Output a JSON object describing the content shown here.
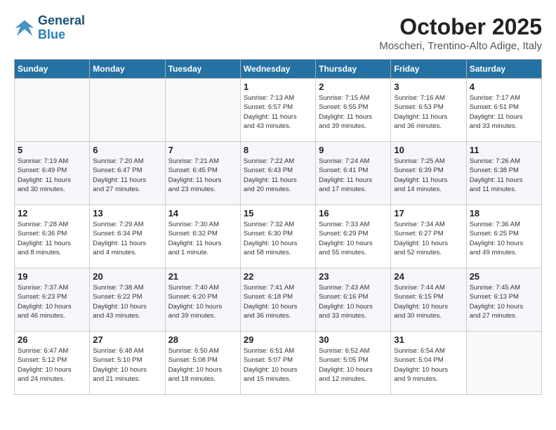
{
  "header": {
    "logo_line1": "General",
    "logo_line2": "Blue",
    "month": "October 2025",
    "location": "Moscheri, Trentino-Alto Adige, Italy"
  },
  "weekdays": [
    "Sunday",
    "Monday",
    "Tuesday",
    "Wednesday",
    "Thursday",
    "Friday",
    "Saturday"
  ],
  "weeks": [
    [
      {
        "day": "",
        "info": ""
      },
      {
        "day": "",
        "info": ""
      },
      {
        "day": "",
        "info": ""
      },
      {
        "day": "1",
        "info": "Sunrise: 7:13 AM\nSunset: 6:57 PM\nDaylight: 11 hours\nand 43 minutes."
      },
      {
        "day": "2",
        "info": "Sunrise: 7:15 AM\nSunset: 6:55 PM\nDaylight: 11 hours\nand 39 minutes."
      },
      {
        "day": "3",
        "info": "Sunrise: 7:16 AM\nSunset: 6:53 PM\nDaylight: 11 hours\nand 36 minutes."
      },
      {
        "day": "4",
        "info": "Sunrise: 7:17 AM\nSunset: 6:51 PM\nDaylight: 11 hours\nand 33 minutes."
      }
    ],
    [
      {
        "day": "5",
        "info": "Sunrise: 7:19 AM\nSunset: 6:49 PM\nDaylight: 11 hours\nand 30 minutes."
      },
      {
        "day": "6",
        "info": "Sunrise: 7:20 AM\nSunset: 6:47 PM\nDaylight: 11 hours\nand 27 minutes."
      },
      {
        "day": "7",
        "info": "Sunrise: 7:21 AM\nSunset: 6:45 PM\nDaylight: 11 hours\nand 23 minutes."
      },
      {
        "day": "8",
        "info": "Sunrise: 7:22 AM\nSunset: 6:43 PM\nDaylight: 11 hours\nand 20 minutes."
      },
      {
        "day": "9",
        "info": "Sunrise: 7:24 AM\nSunset: 6:41 PM\nDaylight: 11 hours\nand 17 minutes."
      },
      {
        "day": "10",
        "info": "Sunrise: 7:25 AM\nSunset: 6:39 PM\nDaylight: 11 hours\nand 14 minutes."
      },
      {
        "day": "11",
        "info": "Sunrise: 7:26 AM\nSunset: 6:38 PM\nDaylight: 11 hours\nand 11 minutes."
      }
    ],
    [
      {
        "day": "12",
        "info": "Sunrise: 7:28 AM\nSunset: 6:36 PM\nDaylight: 11 hours\nand 8 minutes."
      },
      {
        "day": "13",
        "info": "Sunrise: 7:29 AM\nSunset: 6:34 PM\nDaylight: 11 hours\nand 4 minutes."
      },
      {
        "day": "14",
        "info": "Sunrise: 7:30 AM\nSunset: 6:32 PM\nDaylight: 11 hours\nand 1 minute."
      },
      {
        "day": "15",
        "info": "Sunrise: 7:32 AM\nSunset: 6:30 PM\nDaylight: 10 hours\nand 58 minutes."
      },
      {
        "day": "16",
        "info": "Sunrise: 7:33 AM\nSunset: 6:29 PM\nDaylight: 10 hours\nand 55 minutes."
      },
      {
        "day": "17",
        "info": "Sunrise: 7:34 AM\nSunset: 6:27 PM\nDaylight: 10 hours\nand 52 minutes."
      },
      {
        "day": "18",
        "info": "Sunrise: 7:36 AM\nSunset: 6:25 PM\nDaylight: 10 hours\nand 49 minutes."
      }
    ],
    [
      {
        "day": "19",
        "info": "Sunrise: 7:37 AM\nSunset: 6:23 PM\nDaylight: 10 hours\nand 46 minutes."
      },
      {
        "day": "20",
        "info": "Sunrise: 7:38 AM\nSunset: 6:22 PM\nDaylight: 10 hours\nand 43 minutes."
      },
      {
        "day": "21",
        "info": "Sunrise: 7:40 AM\nSunset: 6:20 PM\nDaylight: 10 hours\nand 39 minutes."
      },
      {
        "day": "22",
        "info": "Sunrise: 7:41 AM\nSunset: 6:18 PM\nDaylight: 10 hours\nand 36 minutes."
      },
      {
        "day": "23",
        "info": "Sunrise: 7:43 AM\nSunset: 6:16 PM\nDaylight: 10 hours\nand 33 minutes."
      },
      {
        "day": "24",
        "info": "Sunrise: 7:44 AM\nSunset: 6:15 PM\nDaylight: 10 hours\nand 30 minutes."
      },
      {
        "day": "25",
        "info": "Sunrise: 7:45 AM\nSunset: 6:13 PM\nDaylight: 10 hours\nand 27 minutes."
      }
    ],
    [
      {
        "day": "26",
        "info": "Sunrise: 6:47 AM\nSunset: 5:12 PM\nDaylight: 10 hours\nand 24 minutes."
      },
      {
        "day": "27",
        "info": "Sunrise: 6:48 AM\nSunset: 5:10 PM\nDaylight: 10 hours\nand 21 minutes."
      },
      {
        "day": "28",
        "info": "Sunrise: 6:50 AM\nSunset: 5:08 PM\nDaylight: 10 hours\nand 18 minutes."
      },
      {
        "day": "29",
        "info": "Sunrise: 6:51 AM\nSunset: 5:07 PM\nDaylight: 10 hours\nand 15 minutes."
      },
      {
        "day": "30",
        "info": "Sunrise: 6:52 AM\nSunset: 5:05 PM\nDaylight: 10 hours\nand 12 minutes."
      },
      {
        "day": "31",
        "info": "Sunrise: 6:54 AM\nSunset: 5:04 PM\nDaylight: 10 hours\nand 9 minutes."
      },
      {
        "day": "",
        "info": ""
      }
    ]
  ]
}
